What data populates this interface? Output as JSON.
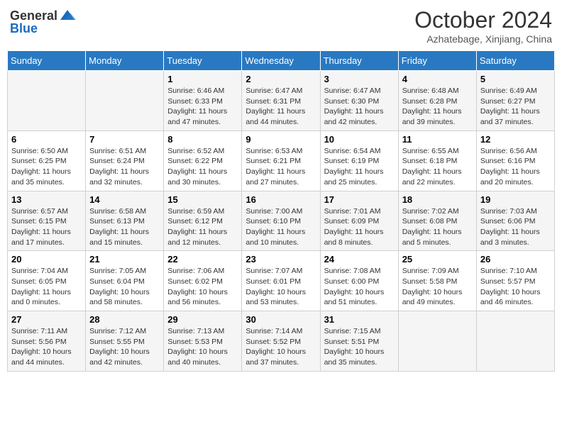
{
  "header": {
    "logo_general": "General",
    "logo_blue": "Blue",
    "month_year": "October 2024",
    "location": "Azhatebage, Xinjiang, China"
  },
  "days_of_week": [
    "Sunday",
    "Monday",
    "Tuesday",
    "Wednesday",
    "Thursday",
    "Friday",
    "Saturday"
  ],
  "weeks": [
    [
      {
        "day": "",
        "content": ""
      },
      {
        "day": "",
        "content": ""
      },
      {
        "day": "1",
        "content": "Sunrise: 6:46 AM\nSunset: 6:33 PM\nDaylight: 11 hours and 47 minutes."
      },
      {
        "day": "2",
        "content": "Sunrise: 6:47 AM\nSunset: 6:31 PM\nDaylight: 11 hours and 44 minutes."
      },
      {
        "day": "3",
        "content": "Sunrise: 6:47 AM\nSunset: 6:30 PM\nDaylight: 11 hours and 42 minutes."
      },
      {
        "day": "4",
        "content": "Sunrise: 6:48 AM\nSunset: 6:28 PM\nDaylight: 11 hours and 39 minutes."
      },
      {
        "day": "5",
        "content": "Sunrise: 6:49 AM\nSunset: 6:27 PM\nDaylight: 11 hours and 37 minutes."
      }
    ],
    [
      {
        "day": "6",
        "content": "Sunrise: 6:50 AM\nSunset: 6:25 PM\nDaylight: 11 hours and 35 minutes."
      },
      {
        "day": "7",
        "content": "Sunrise: 6:51 AM\nSunset: 6:24 PM\nDaylight: 11 hours and 32 minutes."
      },
      {
        "day": "8",
        "content": "Sunrise: 6:52 AM\nSunset: 6:22 PM\nDaylight: 11 hours and 30 minutes."
      },
      {
        "day": "9",
        "content": "Sunrise: 6:53 AM\nSunset: 6:21 PM\nDaylight: 11 hours and 27 minutes."
      },
      {
        "day": "10",
        "content": "Sunrise: 6:54 AM\nSunset: 6:19 PM\nDaylight: 11 hours and 25 minutes."
      },
      {
        "day": "11",
        "content": "Sunrise: 6:55 AM\nSunset: 6:18 PM\nDaylight: 11 hours and 22 minutes."
      },
      {
        "day": "12",
        "content": "Sunrise: 6:56 AM\nSunset: 6:16 PM\nDaylight: 11 hours and 20 minutes."
      }
    ],
    [
      {
        "day": "13",
        "content": "Sunrise: 6:57 AM\nSunset: 6:15 PM\nDaylight: 11 hours and 17 minutes."
      },
      {
        "day": "14",
        "content": "Sunrise: 6:58 AM\nSunset: 6:13 PM\nDaylight: 11 hours and 15 minutes."
      },
      {
        "day": "15",
        "content": "Sunrise: 6:59 AM\nSunset: 6:12 PM\nDaylight: 11 hours and 12 minutes."
      },
      {
        "day": "16",
        "content": "Sunrise: 7:00 AM\nSunset: 6:10 PM\nDaylight: 11 hours and 10 minutes."
      },
      {
        "day": "17",
        "content": "Sunrise: 7:01 AM\nSunset: 6:09 PM\nDaylight: 11 hours and 8 minutes."
      },
      {
        "day": "18",
        "content": "Sunrise: 7:02 AM\nSunset: 6:08 PM\nDaylight: 11 hours and 5 minutes."
      },
      {
        "day": "19",
        "content": "Sunrise: 7:03 AM\nSunset: 6:06 PM\nDaylight: 11 hours and 3 minutes."
      }
    ],
    [
      {
        "day": "20",
        "content": "Sunrise: 7:04 AM\nSunset: 6:05 PM\nDaylight: 11 hours and 0 minutes."
      },
      {
        "day": "21",
        "content": "Sunrise: 7:05 AM\nSunset: 6:04 PM\nDaylight: 10 hours and 58 minutes."
      },
      {
        "day": "22",
        "content": "Sunrise: 7:06 AM\nSunset: 6:02 PM\nDaylight: 10 hours and 56 minutes."
      },
      {
        "day": "23",
        "content": "Sunrise: 7:07 AM\nSunset: 6:01 PM\nDaylight: 10 hours and 53 minutes."
      },
      {
        "day": "24",
        "content": "Sunrise: 7:08 AM\nSunset: 6:00 PM\nDaylight: 10 hours and 51 minutes."
      },
      {
        "day": "25",
        "content": "Sunrise: 7:09 AM\nSunset: 5:58 PM\nDaylight: 10 hours and 49 minutes."
      },
      {
        "day": "26",
        "content": "Sunrise: 7:10 AM\nSunset: 5:57 PM\nDaylight: 10 hours and 46 minutes."
      }
    ],
    [
      {
        "day": "27",
        "content": "Sunrise: 7:11 AM\nSunset: 5:56 PM\nDaylight: 10 hours and 44 minutes."
      },
      {
        "day": "28",
        "content": "Sunrise: 7:12 AM\nSunset: 5:55 PM\nDaylight: 10 hours and 42 minutes."
      },
      {
        "day": "29",
        "content": "Sunrise: 7:13 AM\nSunset: 5:53 PM\nDaylight: 10 hours and 40 minutes."
      },
      {
        "day": "30",
        "content": "Sunrise: 7:14 AM\nSunset: 5:52 PM\nDaylight: 10 hours and 37 minutes."
      },
      {
        "day": "31",
        "content": "Sunrise: 7:15 AM\nSunset: 5:51 PM\nDaylight: 10 hours and 35 minutes."
      },
      {
        "day": "",
        "content": ""
      },
      {
        "day": "",
        "content": ""
      }
    ]
  ]
}
